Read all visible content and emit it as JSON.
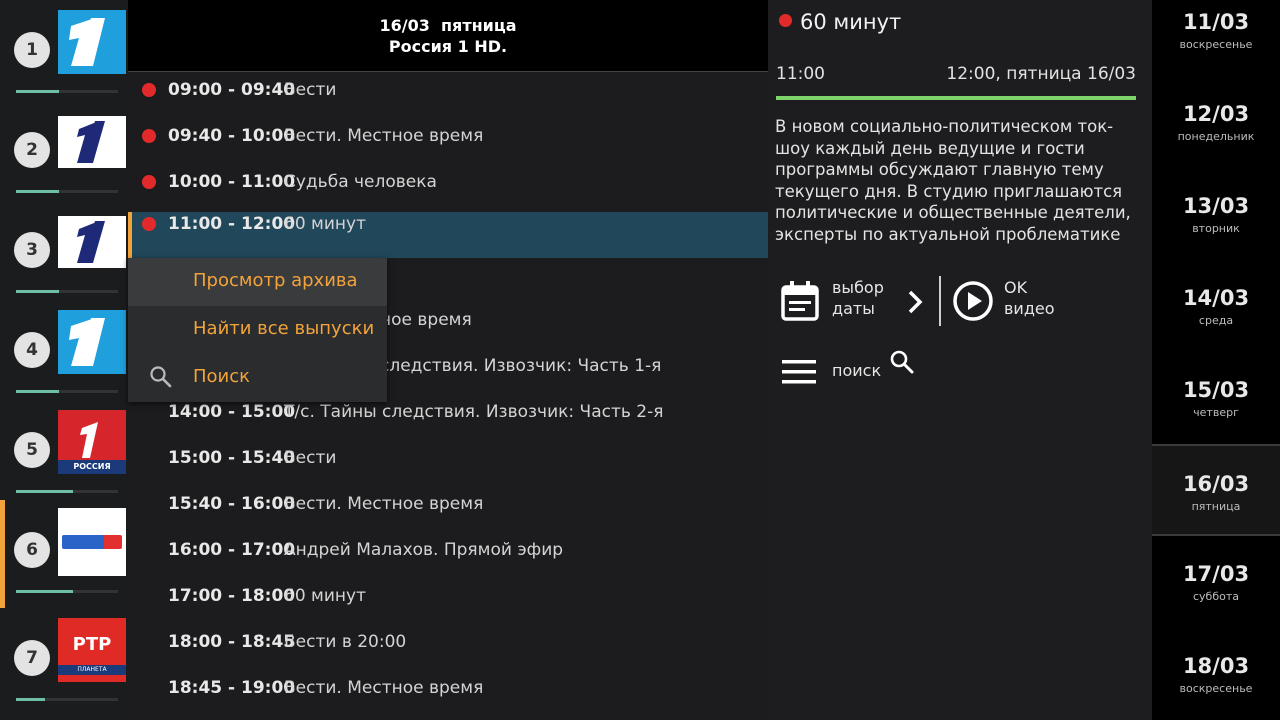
{
  "channels": [
    {
      "number": "1",
      "logo": "perviy-kanal-logo"
    },
    {
      "number": "2",
      "logo": "perviy-kanal-logo"
    },
    {
      "number": "3",
      "logo": "perviy-kanal-logo"
    },
    {
      "number": "4",
      "logo": "perviy-kanal-logo"
    },
    {
      "number": "5",
      "logo": "perviy-kanal-russia-logo",
      "logo_text": "РОССИЯ"
    },
    {
      "number": "6",
      "logo": "russia-1-logo"
    },
    {
      "number": "7",
      "logo": "rtr-planeta-logo",
      "logo_text": "РТР",
      "logo_subtext": "ПЛАНЕТА"
    }
  ],
  "guide": {
    "date_line": "16/03  пятница",
    "channel_line": "Россия 1 HD.",
    "programs": [
      {
        "time": "09:00 - 09:40",
        "title": "Вести",
        "recorded": true
      },
      {
        "time": "09:40 - 10:00",
        "title": "Вести. Местное время",
        "recorded": true
      },
      {
        "time": "10:00 - 11:00",
        "title": "Судьба человека",
        "recorded": true
      },
      {
        "time": "11:00 - 12:00",
        "title": "60 минут",
        "recorded": true,
        "selected": true
      },
      {
        "time": "",
        "title": "",
        "recorded": false
      },
      {
        "time": "",
        "title": "ное время",
        "recorded": false
      },
      {
        "time": "",
        "title": "следствия. Извозчик: Часть 1-я",
        "recorded": false
      },
      {
        "time": "14:00 - 15:00",
        "title": "Т/с. Тайны следствия. Извозчик: Часть 2-я",
        "recorded": false
      },
      {
        "time": "15:00 - 15:40",
        "title": "Вести",
        "recorded": false
      },
      {
        "time": "15:40 - 16:00",
        "title": "Вести. Местное время",
        "recorded": false
      },
      {
        "time": "16:00 - 17:00",
        "title": "Андрей Малахов. Прямой эфир",
        "recorded": false
      },
      {
        "time": "17:00 - 18:00",
        "title": "60 минут",
        "recorded": false
      },
      {
        "time": "18:00 - 18:45",
        "title": "Вести в 20:00",
        "recorded": false
      },
      {
        "time": "18:45 - 19:00",
        "title": "Вести. Местное время",
        "recorded": false
      }
    ]
  },
  "context_menu": {
    "items": [
      {
        "label": "Просмотр архива"
      },
      {
        "label": "Найти все выпуски"
      },
      {
        "label": "Поиск",
        "icon": "search-icon"
      }
    ]
  },
  "detail": {
    "title": "60 минут",
    "start": "11:00",
    "end": "12:00, пятница 16/03",
    "progress": 1.0,
    "description": "В новом социально-политическом ток-шоу каждый день ведущие и гости программы обсуждают главную тему текущего дня. В студию приглашаются политические и общественные деятели, эксперты по актуальной проблематике",
    "date_picker_label_1": "выбор",
    "date_picker_label_2": "даты",
    "ok_label_1": "OK",
    "ok_label_2": "видео",
    "search_label": "поиск"
  },
  "dates": [
    {
      "date": "11/03",
      "day": "воскресенье"
    },
    {
      "date": "12/03",
      "day": "понедельник"
    },
    {
      "date": "13/03",
      "day": "вторник"
    },
    {
      "date": "14/03",
      "day": "среда"
    },
    {
      "date": "15/03",
      "day": "четверг"
    },
    {
      "date": "16/03",
      "day": "пятница",
      "active": true
    },
    {
      "date": "17/03",
      "day": "суббота"
    },
    {
      "date": "18/03",
      "day": "воскресенье"
    }
  ],
  "colors": {
    "accent": "#f2a33a",
    "record": "#e32a2a",
    "selected_row": "#21475a",
    "progress": "#7ed46b"
  }
}
